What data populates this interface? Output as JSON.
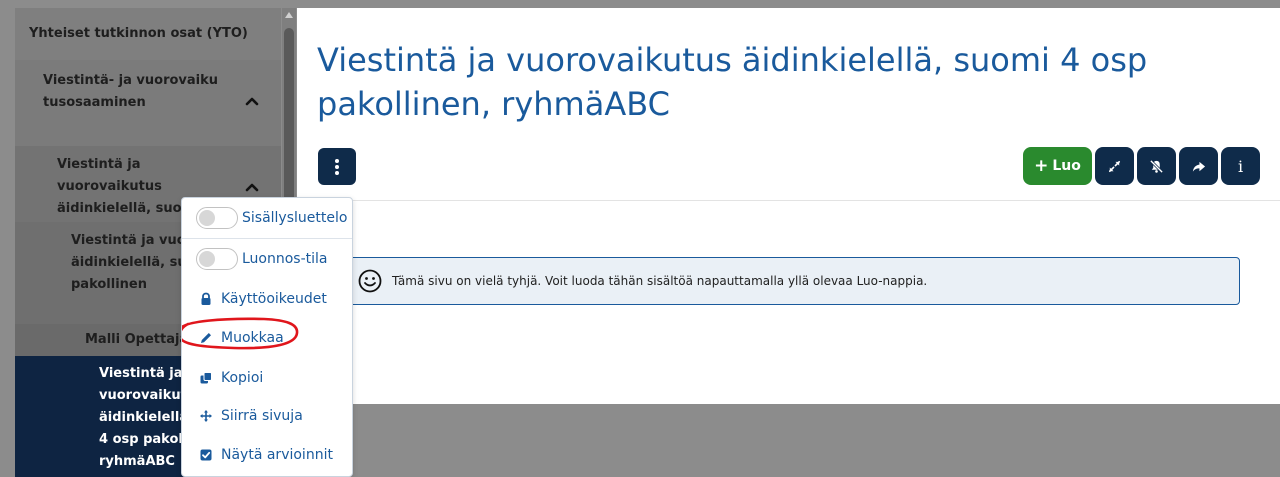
{
  "sidebar": {
    "items": [
      {
        "label": "Yhteiset tutkinnon osat (YTO)"
      },
      {
        "label": "Viestintä- ja vuorovaikutusosaaminen"
      },
      {
        "label": "Viestintä ja vuorovaikutus äidinkielellä, suomi"
      },
      {
        "label": "Viestintä ja vuorovaikutus äidinkielellä, suomi 4 osp pakollinen"
      },
      {
        "label": "Malli Opettaja"
      },
      {
        "label": "Viestintä ja vuorovaikutus äidinkielellä, suomi 4 osp pakollinen, ryhmäABC"
      }
    ],
    "chevron_icon": "chevron-up-icon"
  },
  "page": {
    "title": "Viestintä ja vuorovaikutus äidinkielellä, suomi 4 osp pakollinen, ryhmäABC"
  },
  "toolbar": {
    "luo_label": "Luo",
    "plus_glyph": "+",
    "info_glyph": "i",
    "icons": [
      "expand-icon",
      "bell-slash-icon",
      "share-icon",
      "info-icon"
    ]
  },
  "info_box": {
    "text": "Tämä sivu on vielä tyhjä. Voit luoda tähän sisältöä napauttamalla yllä olevaa Luo-nappia.",
    "icon": "smile-icon"
  },
  "dropdown": {
    "toggles": [
      {
        "label": "Sisällysluettelo",
        "on": false
      },
      {
        "label": "Luonnos-tila",
        "on": false
      }
    ],
    "items": [
      {
        "label": "Käyttöoikeudet",
        "icon": "lock-icon"
      },
      {
        "label": "Muokkaa",
        "icon": "pencil-icon",
        "highlighted": true
      },
      {
        "label": "Kopioi",
        "icon": "copy-icon"
      },
      {
        "label": "Siirrä sivuja",
        "icon": "move-icon"
      },
      {
        "label": "Näytä arvioinnit",
        "icon": "checkbox-icon"
      }
    ]
  },
  "colors": {
    "overlay": "#8c8c8c",
    "title": "#1a5a9c",
    "dark_button": "#0f2b4a",
    "luo_button": "#2a8a2e",
    "highlight_mark": "#e0161c"
  }
}
